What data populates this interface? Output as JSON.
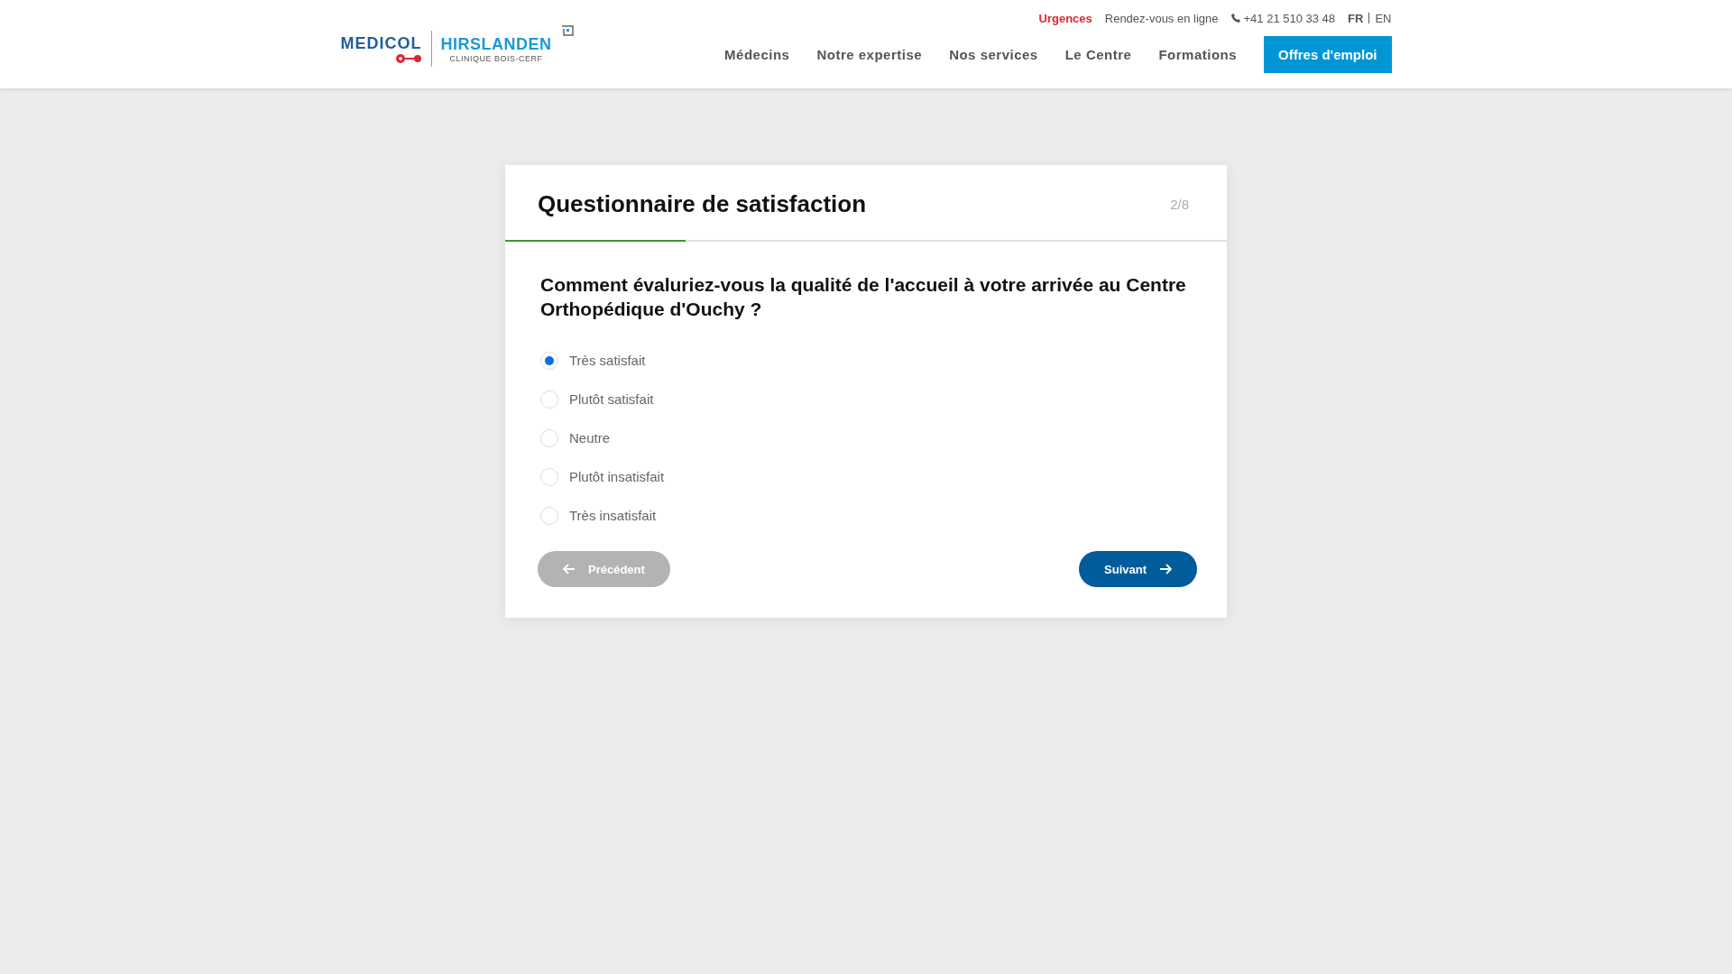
{
  "header": {
    "logo": {
      "brand_1": "MEDICOL",
      "brand_2": "HIRSLANDEN",
      "subtitle": "CLINIQUE BOIS-CERF"
    },
    "top_links": [
      {
        "label": "Urgences",
        "kind": "urgent"
      },
      {
        "label": "Rendez-vous en ligne",
        "kind": "link"
      },
      {
        "label": "+41 21 510 33 48",
        "kind": "phone"
      }
    ],
    "languages": [
      {
        "label": "FR",
        "selected": true
      },
      {
        "label": "EN",
        "selected": false
      }
    ],
    "nav": [
      "Médecins",
      "Notre expertise",
      "Nos services",
      "Le Centre",
      "Formations"
    ],
    "cta": "Offres d'emploi"
  },
  "survey": {
    "title": "Questionnaire de satisfaction",
    "step": "2/8",
    "progress": {
      "level": 0.25
    },
    "question": "Comment évaluriez-vous la qualité de l'accueil à votre arrivée au Centre Orthopédique d'Ouchy ?",
    "options": [
      {
        "label": "Très satisfait",
        "selected": true
      },
      {
        "label": "Plutôt satisfait",
        "selected": false
      },
      {
        "label": "Neutre",
        "selected": false
      },
      {
        "label": "Plutôt insatisfait",
        "selected": false
      },
      {
        "label": "Très insatisfait",
        "selected": false
      }
    ],
    "previous": {
      "label": "Précédent",
      "disabled": true
    },
    "next": {
      "label": "Suivant",
      "disabled": false
    }
  }
}
